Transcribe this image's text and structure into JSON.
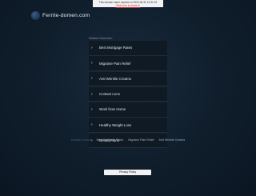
{
  "notice": {
    "line1": "This domain name expired on 2022-05-31 13:31:32",
    "line2": "Click here to renew it."
  },
  "header": {
    "domain": "Ferrite-domen.com"
  },
  "related": {
    "label": "Related Searches:",
    "items": [
      "Best Mortgage Rates",
      "Migraine Pain Relief",
      "Anti Wrinkle Creams",
      "Contact Lens",
      "Work from Home",
      "Healthy Weight Loss",
      "Dental Plans"
    ]
  },
  "bottom_links": [
    "Medical Doctors",
    "Best Mortgage Rates",
    "Migraine Pain Relief",
    "Anti Wrinkle Creams"
  ],
  "footer": {
    "privacy": "Privacy Policy"
  }
}
